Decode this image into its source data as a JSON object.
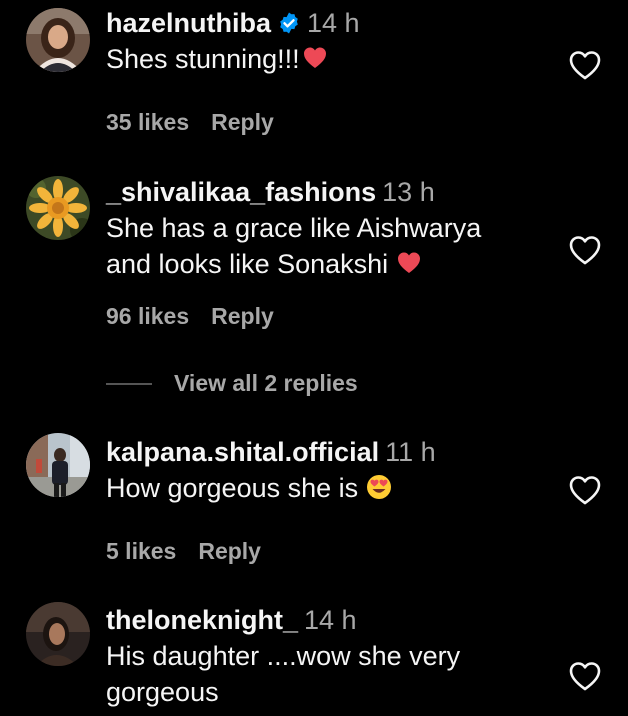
{
  "comments": [
    {
      "username": "hazelnuthiba",
      "verified": true,
      "time": "14 h",
      "text": "Shes stunning!!!",
      "emoji": "red-heart",
      "likes": "35 likes",
      "reply": "Reply",
      "avatar": "profile-photo-woman"
    },
    {
      "username": "_shivalikaa_fashions",
      "verified": false,
      "time": "13 h",
      "text_line1": "She has a grace like Aishwarya",
      "text_line2": "and looks like Sonakshi",
      "emoji": "red-heart",
      "likes": "96 likes",
      "reply": "Reply",
      "avatar": "yellow-dahlia-flower",
      "view_replies": "View all 2 replies"
    },
    {
      "username": "kalpana.shital.official",
      "verified": false,
      "time": "11 h",
      "text": "How gorgeous she is",
      "emoji": "heart-eyes-face",
      "likes": "5 likes",
      "reply": "Reply",
      "avatar": "profile-photo-street"
    },
    {
      "username": "theloneknight_",
      "verified": false,
      "time": "14 h",
      "text_line1": "His daughter ....wow she very",
      "text_line2": "gorgeous",
      "avatar": "profile-photo-man"
    }
  ],
  "colors": {
    "background": "#000000",
    "primary_text": "#f5f5f5",
    "secondary_text": "#a8a8a8",
    "verified_badge": "#0095f6",
    "heart_emoji": "#ed4956"
  }
}
